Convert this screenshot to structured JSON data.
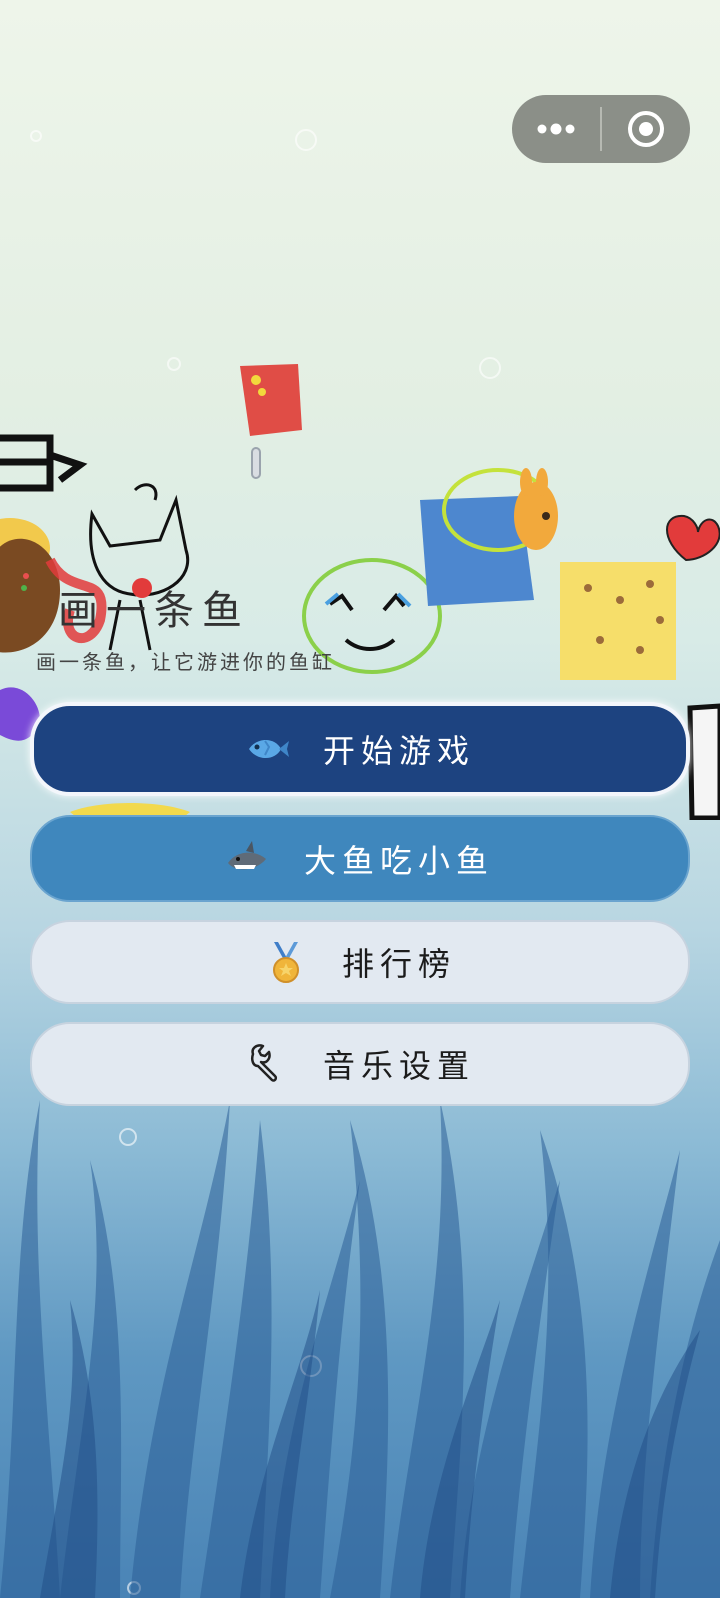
{
  "capsule": {
    "more_icon": "more-dots-icon",
    "close_icon": "target-circle-icon"
  },
  "header": {
    "title": "画一条鱼",
    "subtitle": "画一条鱼，让它游进你的鱼缸"
  },
  "menu": {
    "start": {
      "label": "开始游戏",
      "icon": "fish-icon"
    },
    "big_fish": {
      "label": "大鱼吃小鱼",
      "icon": "shark-icon"
    },
    "ranking": {
      "label": "排行榜",
      "icon": "medal-icon"
    },
    "music": {
      "label": "音乐设置",
      "icon": "wrench-icon"
    }
  },
  "colors": {
    "start_button": "#1d4380",
    "bigfish_button": "#3f87bd",
    "light_button": "#e2e9f1",
    "capsule": "#8b8f88"
  }
}
